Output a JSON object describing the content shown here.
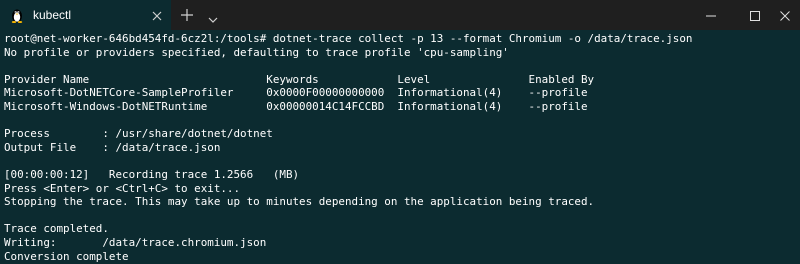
{
  "titlebar": {
    "tab": {
      "label": "kubectl",
      "icon": "linux-penguin-icon"
    },
    "new_tab_icon": "plus-icon",
    "dropdown_icon": "chevron-down-icon",
    "window_controls": [
      "minimize-icon",
      "maximize-icon",
      "close-icon"
    ]
  },
  "terminal": {
    "background": "#0c2b30",
    "foreground": "#ffffff",
    "lines": [
      "root@net-worker-646bd454fd-6cz2l:/tools# dotnet-trace collect -p 13 --format Chromium -o /data/trace.json",
      "No profile or providers specified, defaulting to trace profile 'cpu-sampling'",
      "",
      "Provider Name                           Keywords            Level               Enabled By",
      "Microsoft-DotNETCore-SampleProfiler     0x0000F00000000000  Informational(4)    --profile",
      "Microsoft-Windows-DotNETRuntime         0x00000014C14FCCBD  Informational(4)    --profile",
      "",
      "Process        : /usr/share/dotnet/dotnet",
      "Output File    : /data/trace.json",
      "",
      "[00:00:00:12]   Recording trace 1.2566   (MB)",
      "Press <Enter> or <Ctrl+C> to exit...",
      "Stopping the trace. This may take up to minutes depending on the application being traced.",
      "",
      "Trace completed.",
      "Writing:       /data/trace.chromium.json",
      "Conversion complete"
    ]
  }
}
